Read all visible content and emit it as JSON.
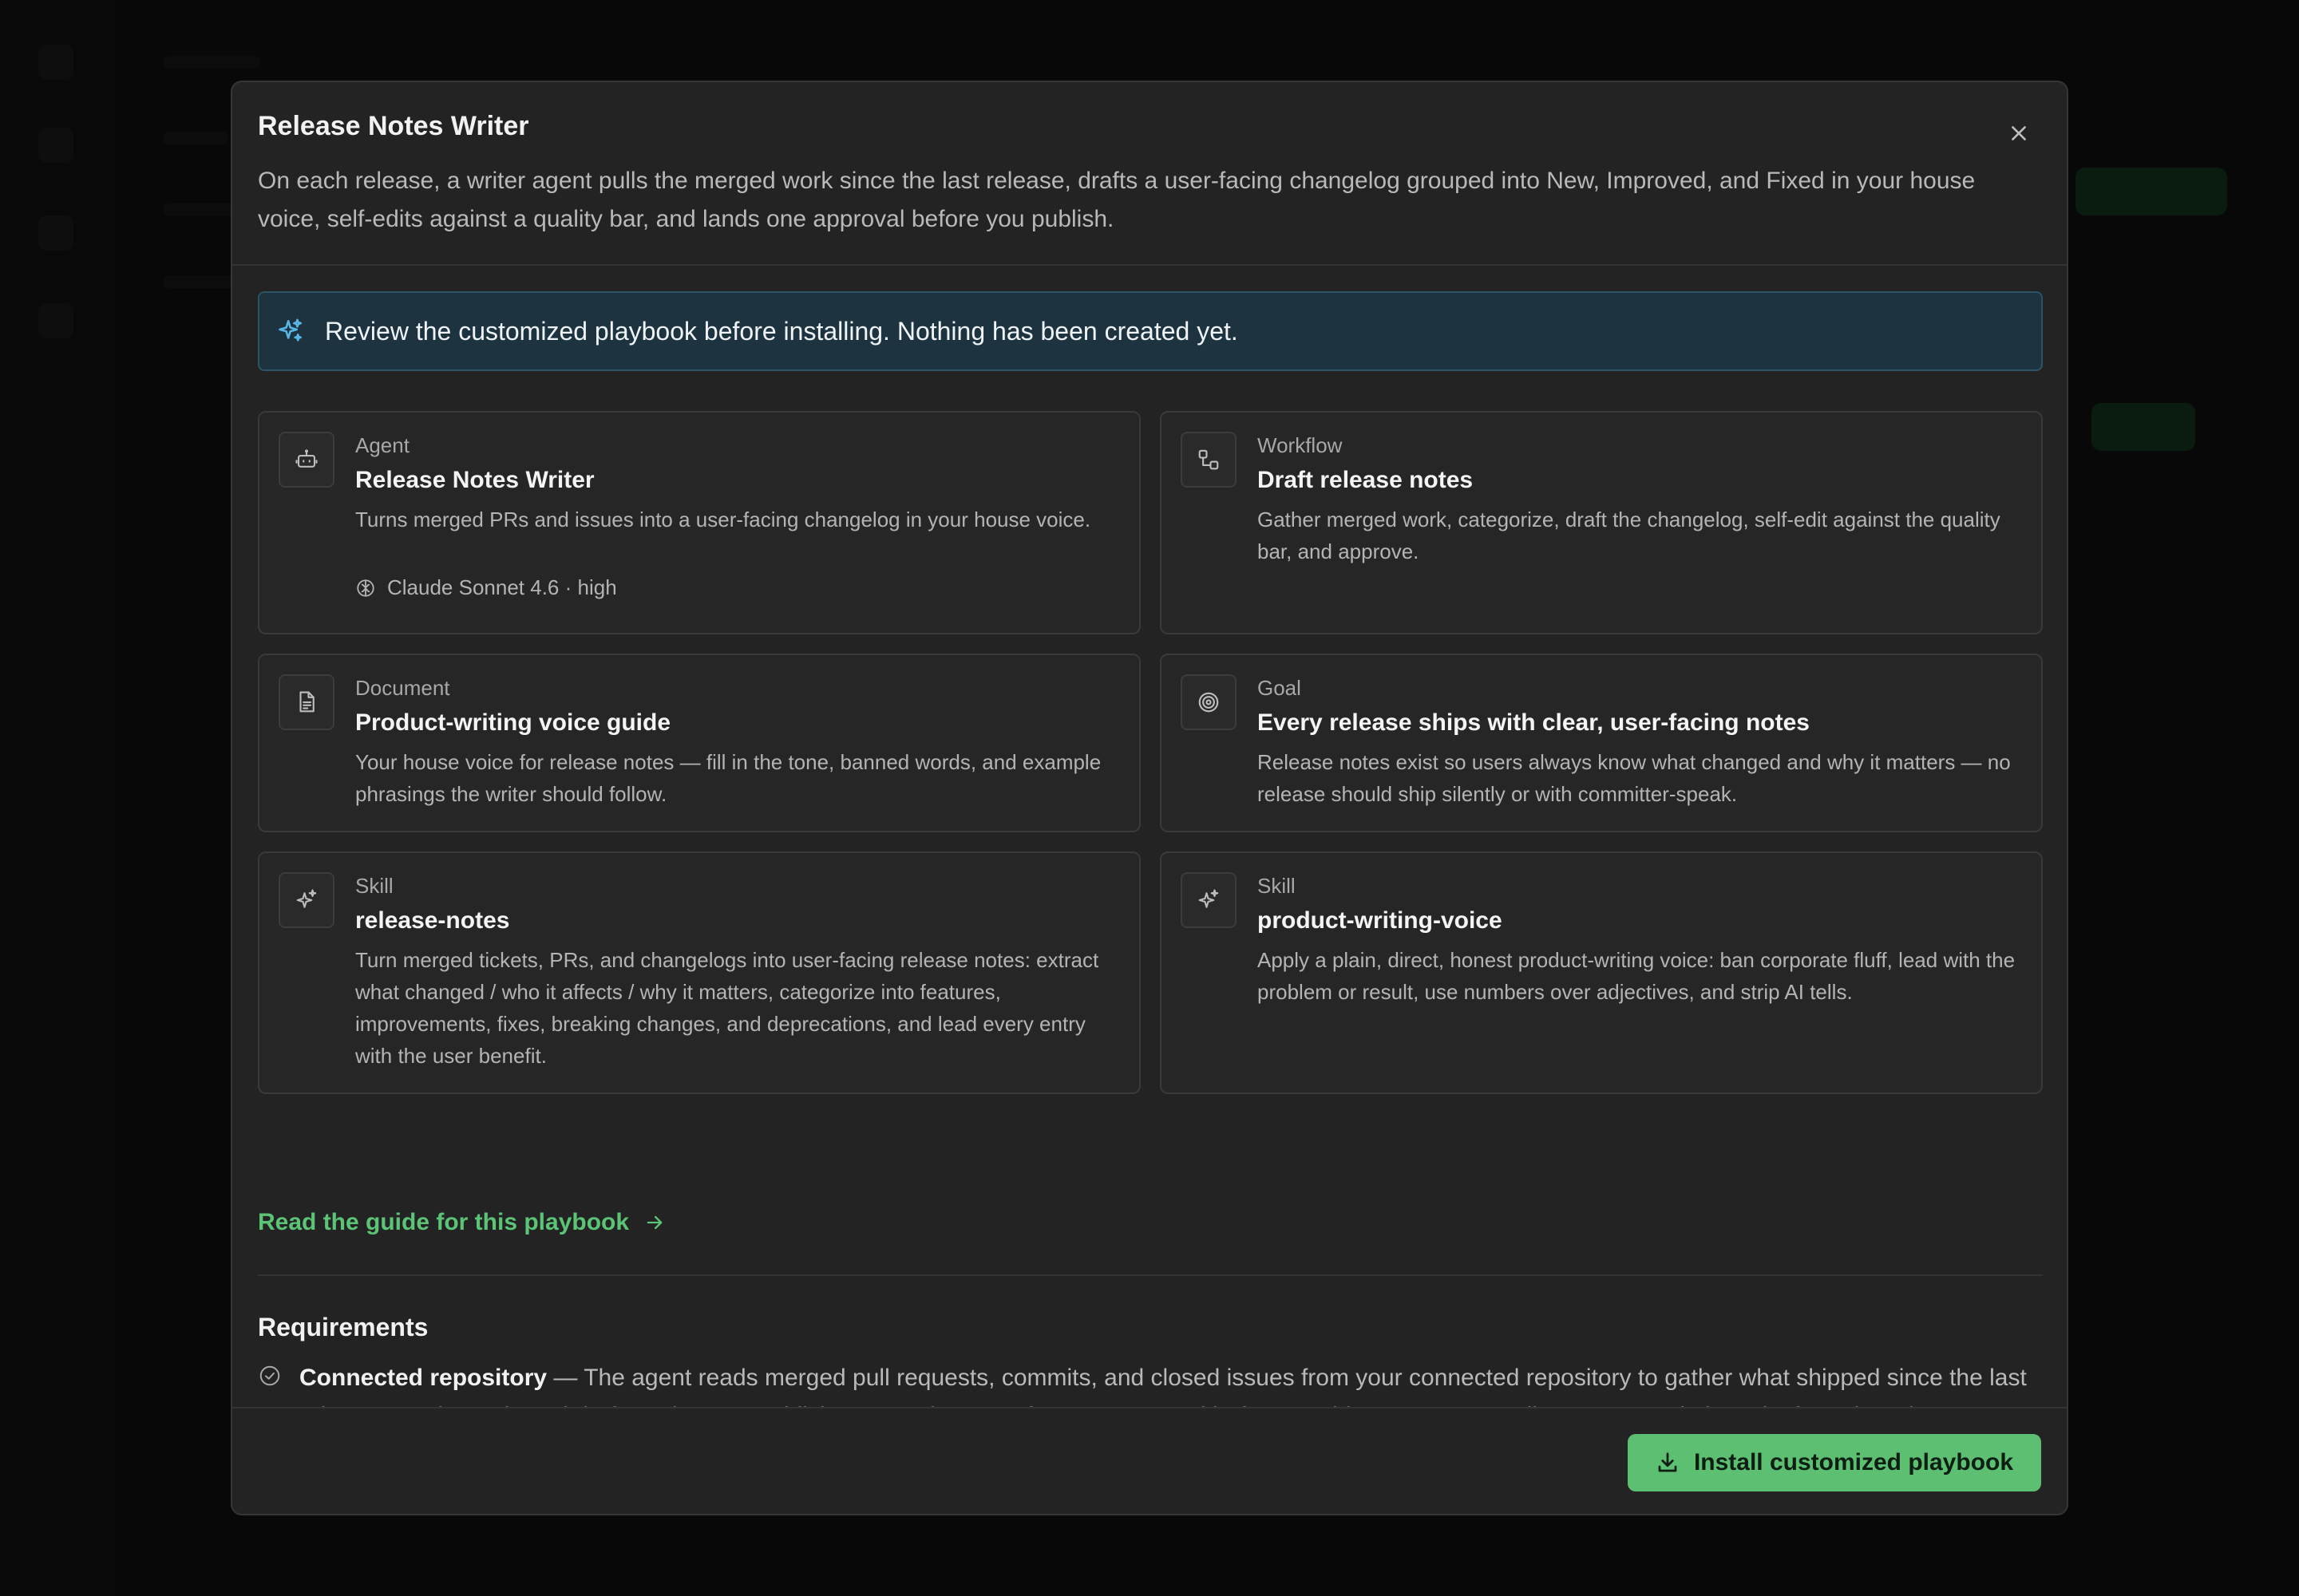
{
  "modal": {
    "title": "Release Notes Writer",
    "description": "On each release, a writer agent pulls the merged work since the last release, drafts a user-facing changelog grouped into New, Improved, and Fixed in your house voice, self-edits against a quality bar, and lands one approval before you publish."
  },
  "notice": {
    "text": "Review the customized playbook before installing. Nothing has been created yet.",
    "icon": "sparkles-icon"
  },
  "cards": [
    {
      "kind": "Agent",
      "name": "Release Notes Writer",
      "desc": "Turns merged PRs and issues into a user-facing changelog in your house voice.",
      "model": "Claude Sonnet 4.6 · high",
      "icon": "robot-icon"
    },
    {
      "kind": "Workflow",
      "name": "Draft release notes",
      "desc": "Gather merged work, categorize, draft the changelog, self-edit against the quality bar, and approve.",
      "icon": "workflow-icon"
    },
    {
      "kind": "Document",
      "name": "Product-writing voice guide",
      "desc": "Your house voice for release notes — fill in the tone, banned words, and example phrasings the writer should follow.",
      "icon": "document-icon"
    },
    {
      "kind": "Goal",
      "name": "Every release ships with clear, user-facing notes",
      "desc": "Release notes exist so users always know what changed and why it matters — no release should ship silently or with committer-speak.",
      "icon": "target-icon"
    },
    {
      "kind": "Skill",
      "name": "release-notes",
      "desc": "Turn merged tickets, PRs, and changelogs into user-facing release notes: extract what changed / who it affects / why it matters, categorize into features, improvements, fixes, breaking changes, and deprecations, and lead every entry with the user benefit.",
      "icon": "sparkles-icon"
    },
    {
      "kind": "Skill",
      "name": "product-writing-voice",
      "desc": "Apply a plain, direct, honest product-writing voice: ban corporate fluff, lead with the problem or result, use numbers over adjectives, and strip AI tells.",
      "icon": "sparkles-icon"
    }
  ],
  "guide_link": "Read the guide for this playbook",
  "requirements": {
    "title": "Requirements",
    "items": [
      {
        "name": "Connected repository",
        "text": " — The agent reads merged pull requests, commits, and closed issues from your connected repository to gather what shipped since the last release. It only reads and drafts — it never publishes — and pauses for your approval before anything goes out. Until you connect it, it works from the release exports you attach."
      }
    ]
  },
  "install_button": "Install customized playbook",
  "colors": {
    "accent_green": "#5cbf72",
    "notice_bg": "#1e3340",
    "modal_bg": "#232323"
  }
}
